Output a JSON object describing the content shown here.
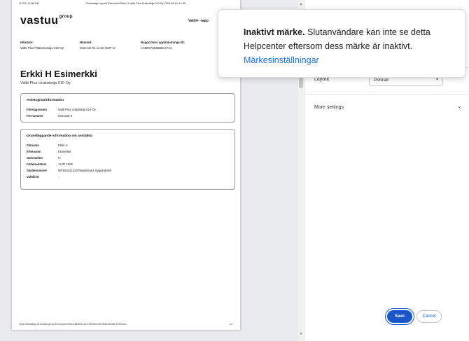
{
  "pdf": {
    "header_left": "2/1/24, 12:55 PM",
    "header_center": "Tarkastaja-raportti Esimerkki Erkki H Valtti Plus Urakoitsija 010 Oy 2024-02-01-12-55",
    "logo": "vastuu",
    "logo_super": "group",
    "brand_right": "Valtti+ -rapp",
    "meta": [
      {
        "label": "Hämtare:",
        "value": "Valtti Plus Pääteteurtaja 010 Oy"
      },
      {
        "label": "Hämtad:",
        "value": "2024-02-01 12:55 GMT+2"
      },
      {
        "label": "Rapportens upphämtnings-ID:",
        "value": "1C8D97AE8BBCCF1A"
      }
    ],
    "person_name": "Erkki H Esimerkki",
    "company": "Valtti Plus Urakoitsija 010 Oy",
    "employer_card": {
      "title": "Arbetsgivarinformation",
      "rows": [
        {
          "k": "Företagsnamn",
          "v": "Valtti Plus Urakoitsija 010 Oy"
        },
        {
          "k": "FO-nummer",
          "v": "0401342-3"
        }
      ]
    },
    "employee_card": {
      "title": "Grundläggande information om anställda",
      "rows": [
        {
          "k": "Förnamn",
          "v": "Erkki H"
        },
        {
          "k": "Efternamn",
          "v": "Esimerkki"
        },
        {
          "k": "Nationalitet",
          "v": "FI"
        },
        {
          "k": "Födelsedatum",
          "v": "14.07.1925"
        },
        {
          "k": "Skattenummer",
          "v": "987654321010 Registrerad: Byggindustri"
        },
        {
          "k": "Valttikort",
          "v": "-"
        }
      ]
    },
    "footer_left": "https://tarkastaja.dev.vastuugroup.fi/employee/6f4ea-88d60221107bb0ae01357384403bd82-87525ea1",
    "footer_right": "1/4"
  },
  "panel": {
    "layout_label": "Layout",
    "layout_value": "Portrait",
    "more_settings": "More settings",
    "save_label": "Save",
    "cancel_label": "Cancel"
  },
  "tooltip": {
    "bold": "Inaktivt märke.",
    "text": " Slutanvändare kan inte se detta Helpcenter eftersom dess märke är inaktivt. ",
    "link": "Märkesinställningar"
  },
  "icons": {
    "caret": "chevron-down-icon",
    "more_chevron": "chevron-down-icon",
    "scroll_up": "arrow-up-icon",
    "scroll_down": "arrow-down-icon"
  },
  "colors": {
    "accent": "#1a56c8",
    "link": "#1a73e8",
    "preview_bg": "#e8eaed"
  }
}
